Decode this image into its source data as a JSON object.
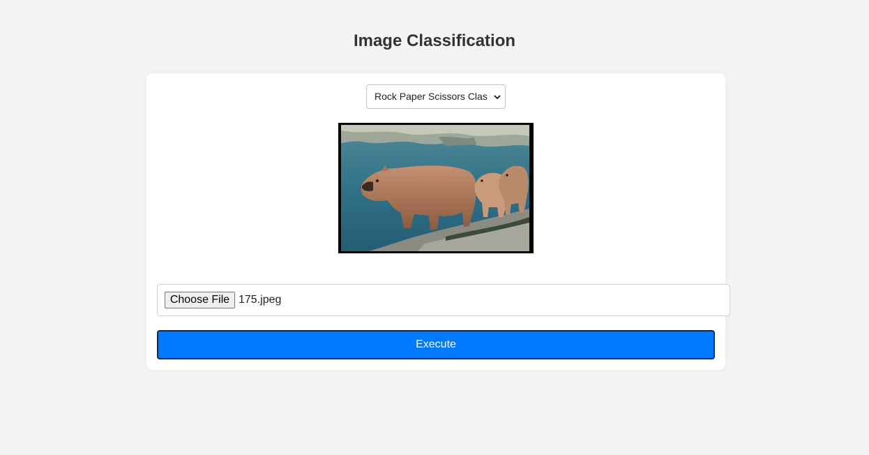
{
  "page": {
    "title": "Image Classification"
  },
  "model_select": {
    "selected_label": "Rock Paper Scissors Clas",
    "icon": "chevron-down-icon"
  },
  "preview": {
    "description_icon": "image-preview"
  },
  "file_input": {
    "button_label": "Choose File",
    "file_name": "175.jpeg"
  },
  "execute": {
    "label": "Execute"
  },
  "colors": {
    "background": "#f4f4f4",
    "card": "#ffffff",
    "accent": "#007bff",
    "title": "#333333"
  }
}
